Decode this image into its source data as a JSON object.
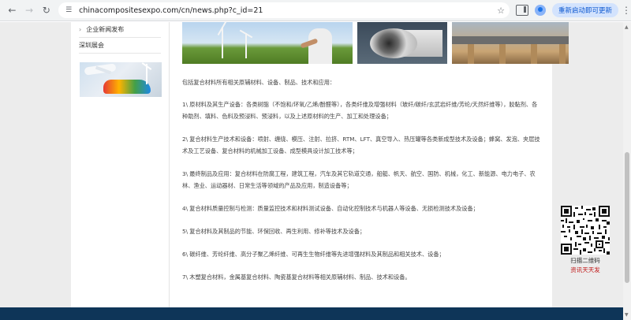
{
  "browser": {
    "url": "chinacompositesexpo.com/cn/news.php?c_id=21",
    "update_label": "重新启动即可更新",
    "icons": {
      "back": "arrow-left-icon",
      "forward": "arrow-right-icon",
      "reload": "reload-icon",
      "site": "site-info-icon",
      "bookmark": "star-icon",
      "side_panel": "side-panel-icon",
      "profile": "profile-icon",
      "menu": "more-vert-icon"
    }
  },
  "sidebar": {
    "items": [
      {
        "label": "企业新闻发布",
        "chevron": "›"
      },
      {
        "label": "深圳展会"
      }
    ]
  },
  "article": {
    "intro": "包括复合材料所有相关原辅材料、设备、制品、技术和应用：",
    "paragraphs": [
      "1\\ 原材料及其生产设备：各类树脂（不饱和/环氧/乙烯/酚醛等），各类纤维及增强材料（玻纤/碳纤/玄武岩纤维/芳纶/天然纤维等），胶黏剂、各种助剂、填料、色料及预浸料、预浸料，以及上述原材料的生产、加工和处理设备；",
      "2\\ 复合材料生产技术和设备：喷射、缠绕、模压、注射、拉挤、RTM、LFT、真空导入、热压罐等各类新成型技术及设备；蜂窝、发泡、夹层技术及工艺设备、复合材料的机械加工设备、成型模具设计加工技术等；",
      "3\\ 最终制品及应用：复合材料在防腐工程，建筑工程，汽车及其它轨道交通，船艇、帆天、航空、国防、机械，化工、新能源、电力电子、农林、渔业、运动器材、日常生活等领域的产品及应用，制造设备等；",
      "4\\ 复合材料质量控制与检测：质量监控技术和材料测试设备、自动化控制技术与机器人等设备、无损检测技术及设备；",
      "5\\ 复合材料及其制品的节能、环保回收、再生利用、修补等技术及设备；",
      "6\\ 碳纤维、芳纶纤维、高分子聚乙烯纤维、可再生生物纤维等先进增强材料及其制品和相关技术、设备；",
      "7\\ 木塑复合材料，金属基复合材料、陶瓷基复合材料等相关原辅材料、制品、技术和设备。"
    ]
  },
  "qr": {
    "caption": "扫描二维码",
    "link_text": "资讯天天发"
  },
  "colors": {
    "footer": "#0e3558",
    "qr_link": "#c01717",
    "update_button_bg": "#d3e3fd",
    "update_button_text": "#0b57d0"
  }
}
